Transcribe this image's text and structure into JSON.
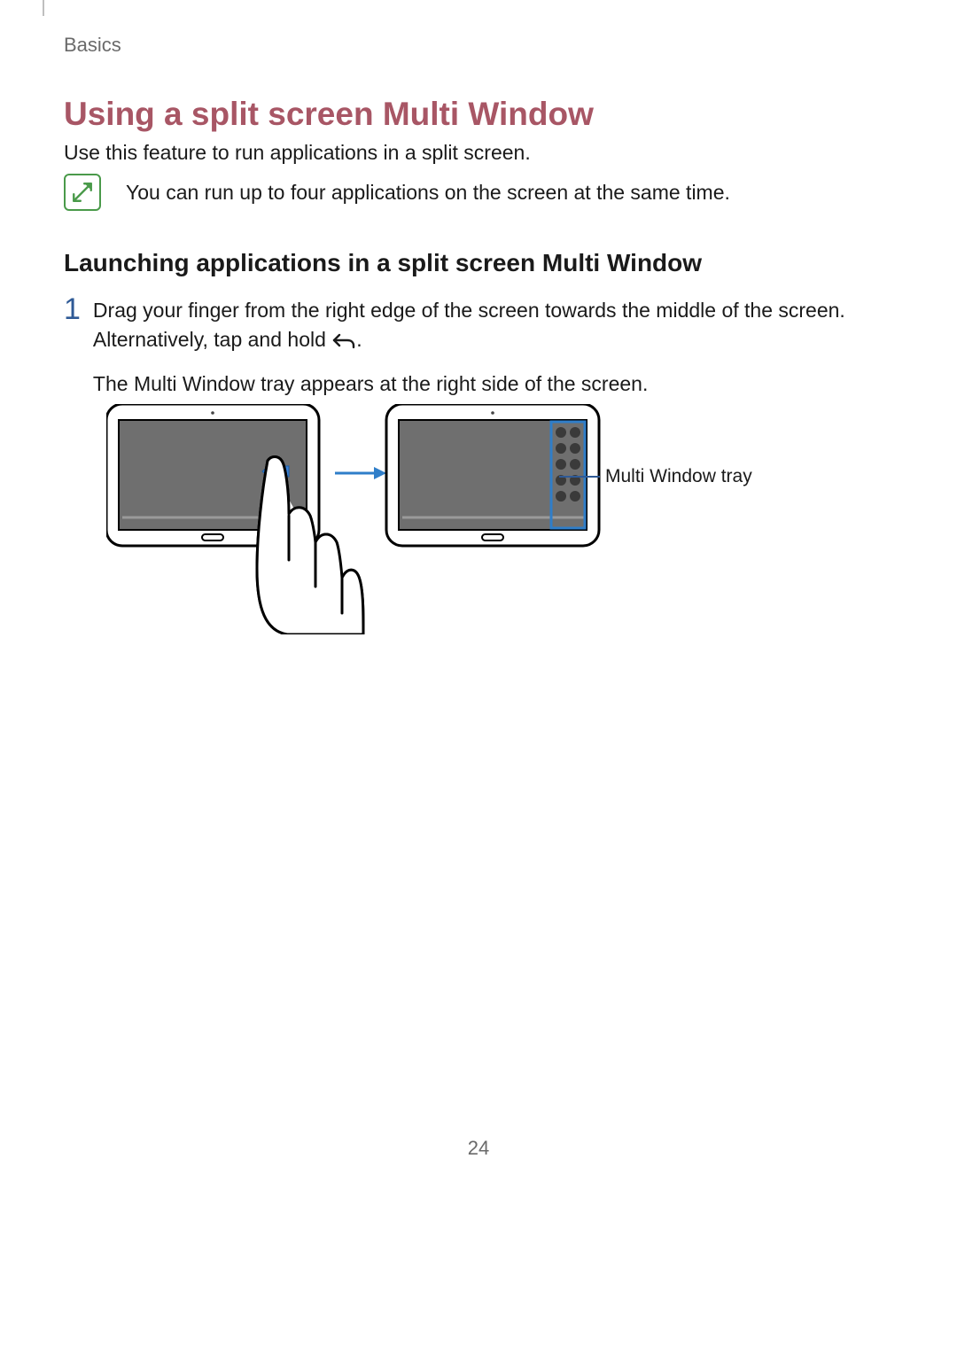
{
  "breadcrumb": "Basics",
  "heading_main": "Using a split screen Multi Window",
  "intro": "Use this feature to run applications in a split screen.",
  "note": {
    "icon_name": "note-icon",
    "text": "You can run up to four applications on the screen at the same time."
  },
  "sub_heading": "Launching applications in a split screen Multi Window",
  "step": {
    "number": "1",
    "line1_a": "Drag your finger from the right edge of the screen towards the middle of the screen. Alternatively, tap and hold ",
    "line1_b": ".",
    "line2": "The Multi Window tray appears at the right side of the screen."
  },
  "figure": {
    "callout": "Multi Window tray"
  },
  "page_number": "24"
}
